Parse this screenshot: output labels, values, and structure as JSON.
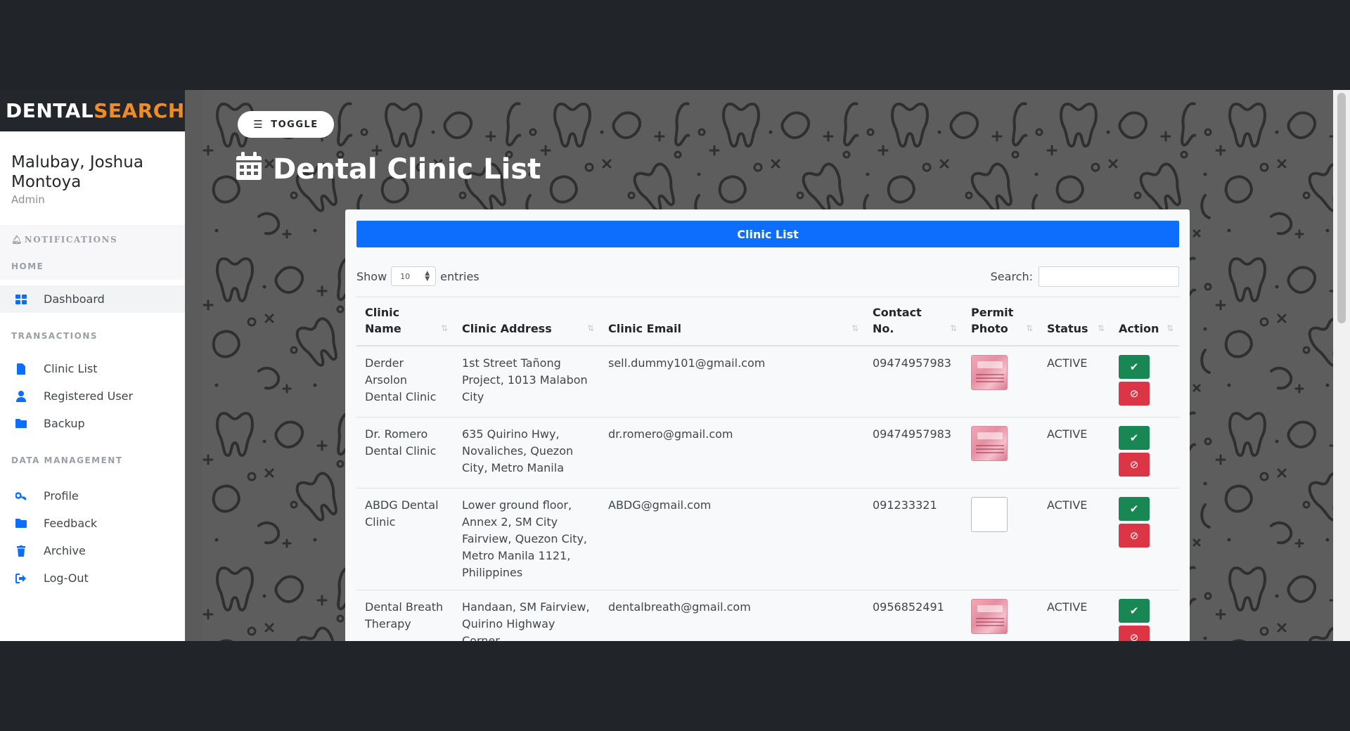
{
  "brand": {
    "part1": "DENTAL",
    "part2": "SEARCH"
  },
  "user": {
    "name": "Malubay, Joshua Montoya",
    "role": "Admin"
  },
  "sidebar": {
    "notifications_label": "NOTIFICATIONS",
    "home_label": "HOME",
    "transactions_label": "TRANSACTIONS",
    "data_management_label": "DATA MANAGEMENT",
    "home_items": [
      {
        "label": "Dashboard",
        "icon": "grid-icon"
      }
    ],
    "transaction_items": [
      {
        "label": "Clinic List",
        "icon": "file-icon"
      },
      {
        "label": "Registered User",
        "icon": "user-icon"
      },
      {
        "label": "Backup",
        "icon": "folder-icon"
      }
    ],
    "data_items": [
      {
        "label": "Profile",
        "icon": "key-icon"
      },
      {
        "label": "Feedback",
        "icon": "folder-icon"
      },
      {
        "label": "Archive",
        "icon": "trash-icon"
      },
      {
        "label": "Log-Out",
        "icon": "logout-icon"
      }
    ]
  },
  "header": {
    "toggle_label": "TOGGLE",
    "page_title": "Dental Clinic List"
  },
  "card": {
    "title": "Clinic List",
    "show_label": "Show",
    "entries_value": "10",
    "entries_label": "entries",
    "search_label": "Search:"
  },
  "table": {
    "columns": [
      "Clinic Name",
      "Clinic Address",
      "Clinic Email",
      "Contact No.",
      "Permit Photo",
      "Status",
      "Action"
    ],
    "rows": [
      {
        "name": "Derder Arsolon Dental Clinic",
        "address": "1st Street Tañong Project, 1013 Malabon City",
        "email": "sell.dummy101@gmail.com",
        "contact": "09474957983",
        "status": "ACTIVE"
      },
      {
        "name": "Dr. Romero Dental Clinic",
        "address": "635 Quirino Hwy, Novaliches, Quezon City, Metro Manila",
        "email": "dr.romero@gmail.com",
        "contact": "09474957983",
        "status": "ACTIVE"
      },
      {
        "name": "ABDG Dental Clinic",
        "address": "Lower ground floor, Annex 2, SM City Fairview, Quezon City, Metro Manila 1121, Philippines",
        "email": "ABDG@gmail.com",
        "contact": "091233321",
        "status": "ACTIVE"
      },
      {
        "name": "Dental Breath Therapy",
        "address": "Handaan, SM Fairview, Quirino Highway Corner",
        "email": "dentalbreath@gmail.com",
        "contact": "0956852491",
        "status": "ACTIVE"
      }
    ]
  },
  "colors": {
    "primary": "#0d6efd",
    "success": "#198754",
    "danger": "#dc3545",
    "brand_accent": "#f08c28"
  }
}
